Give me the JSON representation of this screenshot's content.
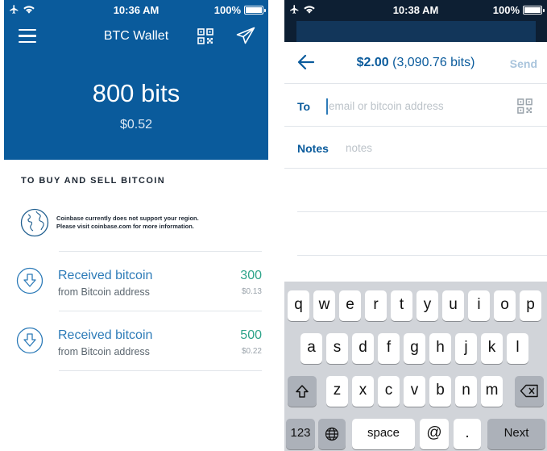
{
  "left_screen": {
    "status_bar": {
      "time": "10:36 AM",
      "battery": "100%"
    },
    "nav": {
      "title": "BTC Wallet"
    },
    "balance": {
      "bits": "800 bits",
      "usd": "$0.52"
    },
    "buy_sell_heading": "TO BUY AND SELL BITCOIN",
    "region_notice": {
      "line1": "Coinbase currently does not support your region.",
      "line2": "Please visit coinbase.com for more information."
    },
    "transactions": [
      {
        "title": "Received bitcoin",
        "subtitle": "from Bitcoin address",
        "amount": "300",
        "usd": "$0.13"
      },
      {
        "title": "Received bitcoin",
        "subtitle": "from Bitcoin address",
        "amount": "500",
        "usd": "$0.22"
      }
    ]
  },
  "right_screen": {
    "status_bar": {
      "time": "10:38 AM",
      "battery": "100%"
    },
    "header": {
      "amount": "$2.00",
      "bits": "(3,090.76 bits)",
      "send_label": "Send"
    },
    "to_field": {
      "label": "To",
      "placeholder": "email or bitcoin address",
      "value": ""
    },
    "notes_field": {
      "label": "Notes",
      "placeholder": "notes",
      "value": ""
    },
    "keyboard": {
      "row1": [
        "q",
        "w",
        "e",
        "r",
        "t",
        "y",
        "u",
        "i",
        "o",
        "p"
      ],
      "row2": [
        "a",
        "s",
        "d",
        "f",
        "g",
        "h",
        "j",
        "k",
        "l"
      ],
      "row3": [
        "z",
        "x",
        "c",
        "v",
        "b",
        "n",
        "m"
      ],
      "numbers_key": "123",
      "space_key": "space",
      "at_key": "@",
      "dot_key": ".",
      "next_key": "Next"
    }
  },
  "colors": {
    "brand_blue": "#0a5b9c",
    "link_blue": "#2d7bb8",
    "amount_green": "#2ea48a",
    "keyboard_bg": "#d1d4d9"
  }
}
